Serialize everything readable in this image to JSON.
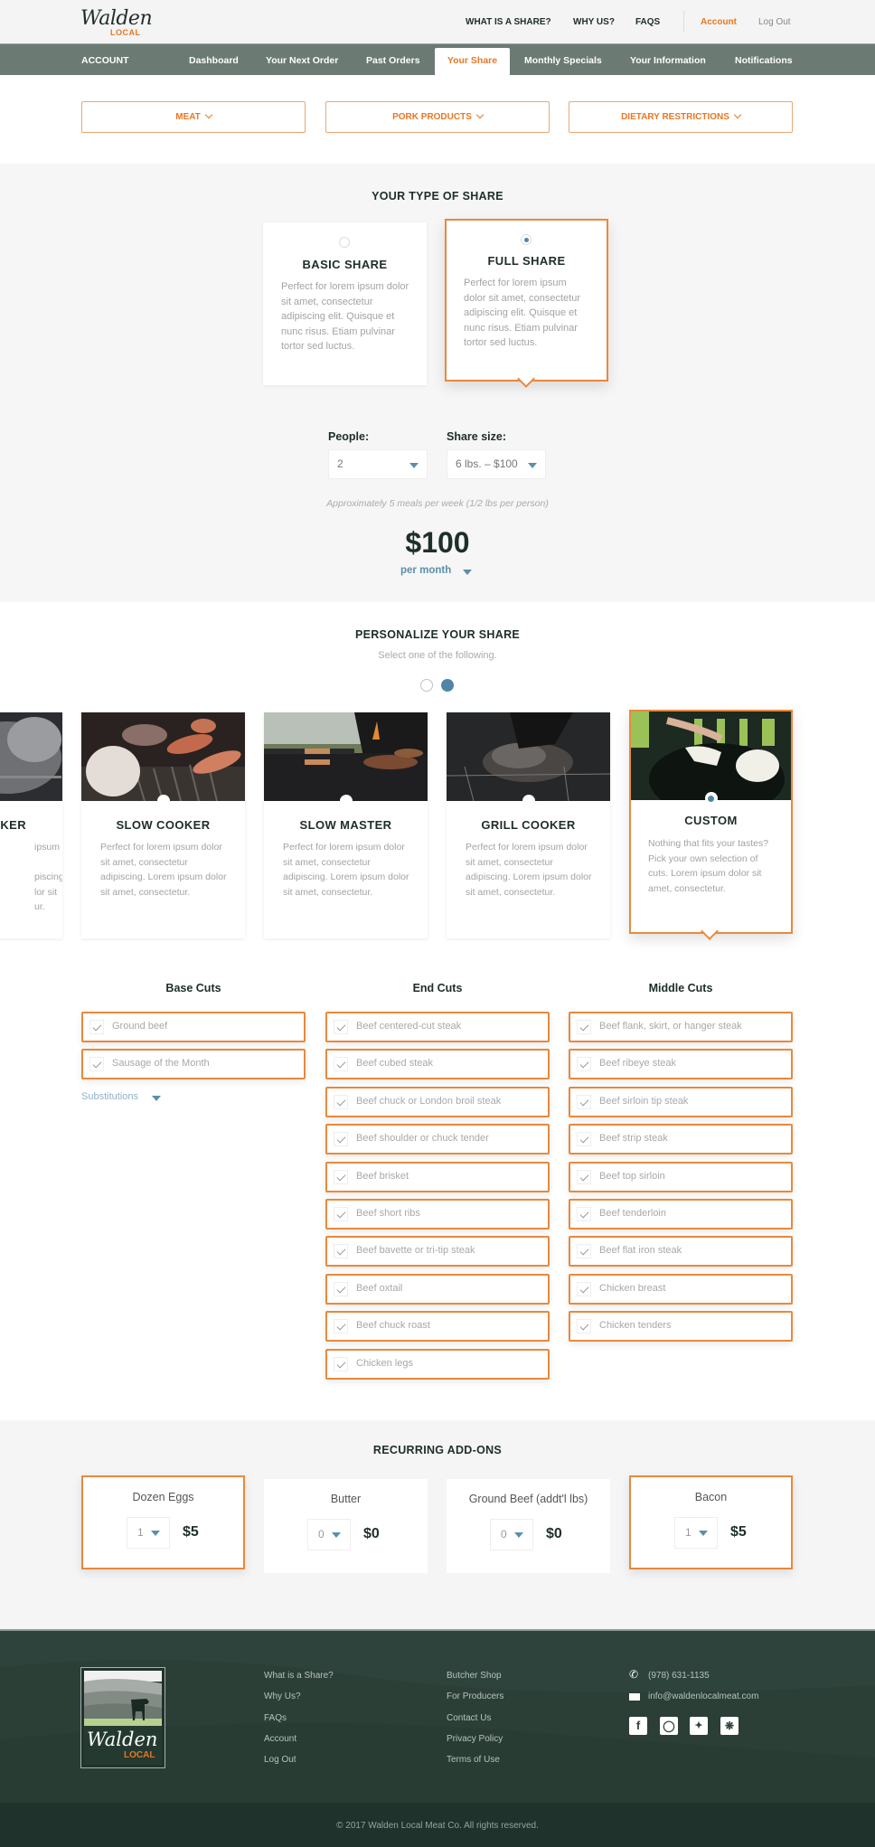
{
  "header": {
    "logo_script": "Walden",
    "logo_sub": "LOCAL",
    "nav": [
      "WHAT IS A SHARE?",
      "WHY US?",
      "FAQS"
    ],
    "account": "Account",
    "logout": "Log Out"
  },
  "account_nav": {
    "label": "ACCOUNT",
    "tabs": [
      "Dashboard",
      "Your Next Order",
      "Past Orders",
      "Your Share",
      "Monthly Specials",
      "Your Information",
      "Notifications"
    ],
    "active": "Your Share"
  },
  "filters": [
    "MEAT",
    "PORK PRODUCTS",
    "DIETARY RESTRICTIONS"
  ],
  "share_type": {
    "title": "YOUR TYPE OF SHARE",
    "options": [
      {
        "name": "BASIC SHARE",
        "desc": "Perfect for lorem ipsum dolor sit amet, consectetur adipiscing elit. Quisque et nunc risus. Etiam pulvinar tortor sed luctus.",
        "selected": false
      },
      {
        "name": "FULL SHARE",
        "desc": "Perfect for lorem ipsum dolor sit amet, consectetur adipiscing elit. Quisque et nunc risus. Etiam pulvinar tortor sed luctus.",
        "selected": true
      }
    ],
    "people_label": "People:",
    "people_value": "2",
    "size_label": "Share size:",
    "size_value": "6 lbs. – $100",
    "approx": "Approximately 5 meals per week (1/2 lbs per person)",
    "price": "$100",
    "period": "per month"
  },
  "personalize": {
    "title": "PERSONALIZE YOUR SHARE",
    "subtitle": "Select one of the following.",
    "carousel_pages": 2,
    "carousel_active_page": 2,
    "partial_card": {
      "title": "KER",
      "desc": "ipsum\n\npiscing.\nlor sit\nur."
    },
    "plans": [
      {
        "name": "SLOW COOKER",
        "desc": "Perfect for lorem ipsum dolor sit amet, consectetur adipiscing. Lorem ipsum dolor sit amet, consectetur.",
        "selected": false
      },
      {
        "name": "SLOW MASTER",
        "desc": "Perfect for lorem ipsum dolor sit amet, consectetur adipiscing. Lorem ipsum dolor sit amet, consectetur.",
        "selected": false
      },
      {
        "name": "GRILL COOKER",
        "desc": "Perfect for lorem ipsum dolor sit amet, consectetur adipiscing. Lorem ipsum dolor sit amet, consectetur.",
        "selected": false
      },
      {
        "name": "CUSTOM",
        "desc": "Nothing that fits your tastes? Pick your own selection of cuts. Lorem ipsum dolor sit amet, consectetur.",
        "selected": true
      }
    ]
  },
  "cuts": {
    "base": {
      "title": "Base Cuts",
      "items": [
        "Ground beef",
        "Sausage of the Month"
      ]
    },
    "substitutions": "Substitutions",
    "end": {
      "title": "End Cuts",
      "items": [
        "Beef centered-cut steak",
        "Beef cubed steak",
        "Beef chuck or London broil steak",
        "Beef shoulder or chuck tender",
        "Beef brisket",
        "Beef short ribs",
        "Beef bavette or tri-tip steak",
        "Beef oxtail",
        "Beef chuck roast",
        "Chicken legs"
      ]
    },
    "middle": {
      "title": "Middle Cuts",
      "items": [
        "Beef flank, skirt, or hanger steak",
        "Beef ribeye steak",
        "Beef sirloin tip steak",
        "Beef strip steak",
        "Beef top sirloin",
        "Beef tenderloin",
        "Beef flat iron steak",
        "Chicken breast",
        "Chicken tenders"
      ]
    }
  },
  "addons": {
    "title": "RECURRING ADD-ONS",
    "items": [
      {
        "name": "Dozen Eggs",
        "qty": "1",
        "price": "$5",
        "selected": true
      },
      {
        "name": "Butter",
        "qty": "0",
        "price": "$0",
        "selected": false
      },
      {
        "name": "Ground Beef (addt'l lbs)",
        "qty": "0",
        "price": "$0",
        "selected": false
      },
      {
        "name": "Bacon",
        "qty": "1",
        "price": "$5",
        "selected": true
      }
    ]
  },
  "footer": {
    "logo_script": "Walden",
    "logo_sub": "LOCAL",
    "col1": [
      "What is a Share?",
      "Why Us?",
      "FAQs",
      "Account",
      "Log Out"
    ],
    "col2": [
      "Butcher Shop",
      "For Producers",
      "Contact Us",
      "Privacy Policy",
      "Terms of Use"
    ],
    "phone": "(978) 631-1135",
    "email": "info@waldenlocalmeat.com",
    "social": [
      "facebook",
      "instagram",
      "twitter",
      "yelp"
    ],
    "copyright": "© 2017 Walden Local Meat Co. All rights reserved."
  },
  "colors": {
    "accent": "#e87722",
    "blue": "#4f86a8",
    "nav_bg": "#6b7a72",
    "footer_bg": "#2e433b"
  }
}
